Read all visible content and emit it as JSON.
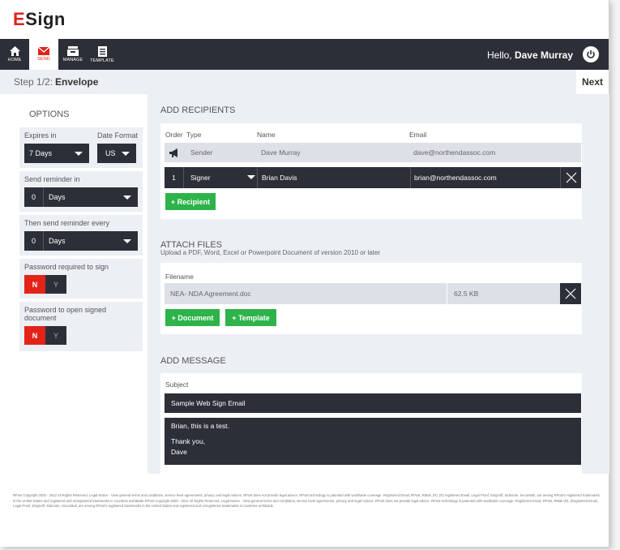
{
  "brand": {
    "logo_e": "E",
    "logo_rest": "Sign"
  },
  "nav": {
    "items": [
      {
        "label": "HOME",
        "icon": "home-icon"
      },
      {
        "label": "SEND",
        "icon": "envelope-icon"
      },
      {
        "label": "MANAGE",
        "icon": "inbox-icon"
      },
      {
        "label": "TEMPLATE",
        "icon": "document-icon"
      }
    ],
    "greeting_prefix": "Hello, ",
    "user_name": "Dave Murray"
  },
  "step": {
    "prefix": "Step 1/2:",
    "name": "Envelope",
    "next_label": "Next"
  },
  "options": {
    "title": "OPTIONS",
    "expires_label": "Expires in",
    "expires_value": "7 Days",
    "date_format_label": "Date Format",
    "date_format_value": "US",
    "send_reminder_label": "Send reminder in",
    "send_reminder_num": "0",
    "send_reminder_unit": "Days",
    "then_reminder_label": "Then send reminder every",
    "then_reminder_num": "0",
    "then_reminder_unit": "Days",
    "password_sign_label": "Password required to sign",
    "password_open_label": "Password to open signed document",
    "toggle_no": "N",
    "toggle_yes": "Y"
  },
  "recipients": {
    "title": "ADD RECIPIENTS",
    "headers": {
      "order": "Order",
      "type": "Type",
      "name": "Name",
      "email": "Email"
    },
    "sender": {
      "type": "Sender",
      "name": "Dave Murray",
      "email": "dave@northendassoc.com"
    },
    "signer": {
      "order": "1",
      "type": "Signer",
      "name": "Brian Davis",
      "email": "brian@northendassoc.com"
    },
    "add_button": "+ Recipient"
  },
  "files": {
    "title": "ATTACH FILES",
    "subtitle": "Upload a PDF, Word, Excel or Powerpoint Document of version 2010 or later",
    "filename_header": "Filename",
    "file_name": "NEA- NDA Agreement.doc",
    "file_size": "62.5 KB",
    "add_document": "+ Document",
    "add_template": "+ Template"
  },
  "message": {
    "title": "ADD MESSAGE",
    "subject_label": "Subject",
    "subject_value": "Sample Web Sign Email",
    "body_line1": "Brian, this is a test.",
    "body_line2": "Thank you,",
    "body_line3": "Dave"
  },
  "footer": "RPost Copyright 2000 - 2012 All Rights Reserved. Legal Notice - View general terms and conditions, service level agreements, privacy and legal notices. RPost does not provide legal advice. RPost technology is patented with worldwide coverage. Registered Email, RPost, RMail, (R), (R) registered Email, Legal Proof, Esignoff, Sidenote, SecurMail, are among RPost's registered trademarks in the United States and registered and unregistered trademarks in countries worldwide.RPost Copyright 2000 - 2012 All Rights Reserved. Legal Notice - View general terms and conditions, service level agreements, privacy and legal notices. RPost does not provide legal advice. RPost technology is patented with worldwide coverage. Registered Email, RPost, RMail (R), (Registered Email, Legal Proof, Esignoff, Sidenote, SecurMail, are among RPost's registered trademarks in the United States and registered and unregistered trademarks in countries worldwide.",
  "colors": {
    "brand_red": "#e2231a",
    "dark": "#2c2f38",
    "green": "#2db34a",
    "panel": "#eceff3"
  }
}
